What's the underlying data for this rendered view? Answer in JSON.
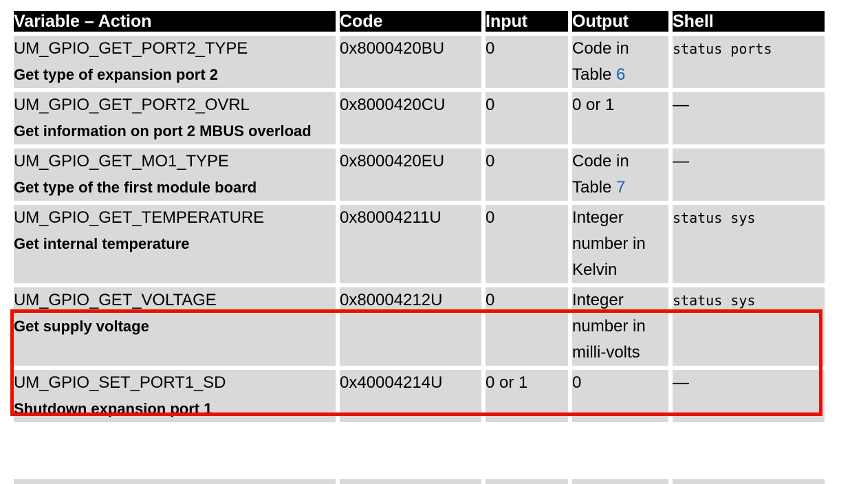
{
  "table": {
    "headers": [
      {
        "label": "Variable – Action"
      },
      {
        "label": "Code"
      },
      {
        "label": "Input"
      },
      {
        "label": "Output"
      },
      {
        "label": "Shell"
      }
    ],
    "rows": [
      {
        "variable": "UM_GPIO_GET_PORT2_TYPE",
        "description": "Get type of expansion port 2",
        "code": "0x8000420BU",
        "input": "0",
        "output_pre": "Code in Table ",
        "output_link": "6",
        "shell": "status ports",
        "shell_mono": true,
        "highlighted": false
      },
      {
        "variable": "UM_GPIO_GET_PORT2_OVRL",
        "description": "Get information on port 2 MBUS overload",
        "code": "0x8000420CU",
        "input": "0",
        "output_pre": "0 or 1",
        "output_link": "",
        "shell": "—",
        "shell_mono": false,
        "highlighted": false
      },
      {
        "variable": "UM_GPIO_GET_MO1_TYPE",
        "description": "Get type of the first module board",
        "code": "0x8000420EU",
        "input": "0",
        "output_pre": "Code in Table ",
        "output_link": "7",
        "shell": "—",
        "shell_mono": false,
        "highlighted": false
      },
      {
        "variable": "UM_GPIO_GET_TEMPERATURE",
        "description": "Get internal temperature",
        "code": "0x80004211U",
        "input": "0",
        "output_pre": "Integer number in Kelvin",
        "output_link": "",
        "shell": "status sys",
        "shell_mono": true,
        "highlighted": false
      },
      {
        "variable": "UM_GPIO_GET_VOLTAGE",
        "description": "Get supply voltage",
        "code": "0x80004212U",
        "input": "0",
        "output_pre": "Integer number in milli-volts",
        "output_link": "",
        "shell": "status sys",
        "shell_mono": true,
        "highlighted": true
      },
      {
        "variable": "UM_GPIO_SET_PORT1_SD",
        "description": "Shutdown expansion port 1",
        "code": "0x40004214U",
        "input": "0 or 1",
        "output_pre": "0",
        "output_link": "",
        "shell": "—",
        "shell_mono": false,
        "highlighted": false
      }
    ]
  },
  "colors": {
    "header_bg": "#000000",
    "header_text": "#ffffff",
    "cell_bg": "#d9d9d9",
    "cell_text": "#000000",
    "link": "#1a5fb4",
    "highlight_border": "#e81100",
    "page_bg": "#ffffff"
  }
}
